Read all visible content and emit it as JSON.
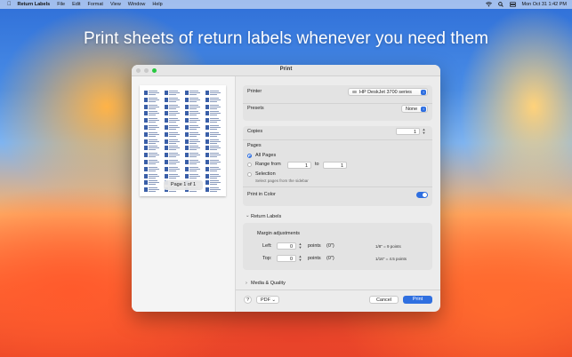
{
  "menubar": {
    "app_name": "Return Labels",
    "items": [
      "File",
      "Edit",
      "Format",
      "View",
      "Window",
      "Help"
    ],
    "clock": "Mon Oct 31  1:42 PM"
  },
  "headline": "Print sheets of return labels whenever you need them",
  "dialog": {
    "title": "Print",
    "preview": {
      "page_badge": "Page 1 of 1"
    },
    "printer": {
      "label": "Printer",
      "value": "HP DeskJet 3700 series"
    },
    "presets": {
      "label": "Presets",
      "value": "None"
    },
    "copies": {
      "label": "Copies",
      "value": "1"
    },
    "pages": {
      "label": "Pages",
      "all": "All Pages",
      "range_from": "Range from",
      "from_value": "1",
      "to": "to",
      "to_value": "1",
      "selection": "Selection",
      "selection_hint": "Select pages from the sidebar",
      "selected": "all"
    },
    "print_in_color": {
      "label": "Print in Color",
      "on": true
    },
    "return_labels": {
      "section": "Return Labels",
      "heading": "Margin adjustments",
      "left_label": "Left:",
      "left_value": "0",
      "left_unit": "points",
      "left_inch": "(0\")",
      "left_note": "1/8\" = 9 points",
      "top_label": "Top:",
      "top_value": "0",
      "top_unit": "points",
      "top_inch": "(0\")",
      "top_note": "1/16\" = 4.5 points"
    },
    "media_quality": "Media & Quality",
    "footer": {
      "help": "?",
      "pdf": "PDF",
      "cancel": "Cancel",
      "print": "Print"
    }
  },
  "colors": {
    "accent": "#2f6fe0",
    "close": "#fe5f57",
    "minimize": "#febc2e",
    "zoom": "#28c840"
  }
}
